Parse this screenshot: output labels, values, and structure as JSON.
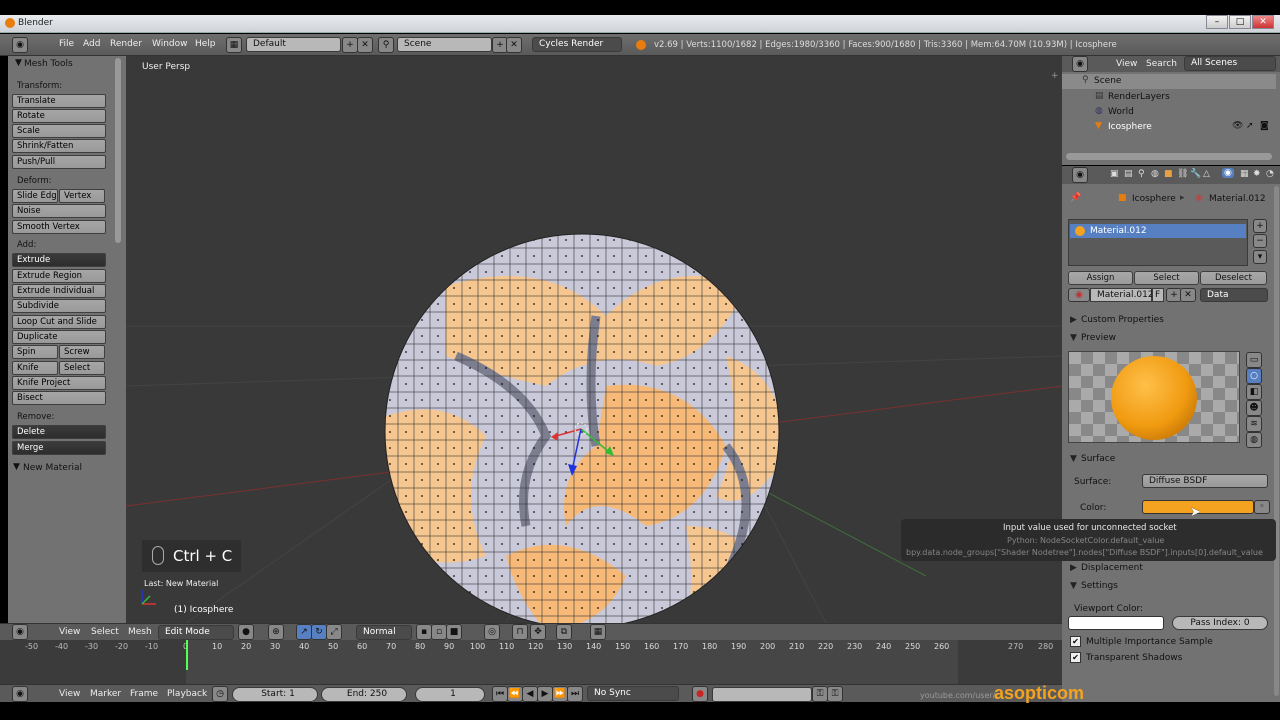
{
  "window": {
    "title": "Blender",
    "min": "–",
    "max": "□",
    "close": "✕"
  },
  "topbar": {
    "menus": [
      "File",
      "Add",
      "Render",
      "Window",
      "Help"
    ],
    "layout": "Default",
    "scene": "Scene",
    "engine": "Cycles Render",
    "stats": "v2.69 | Verts:1100/1682 | Edges:1980/3360 | Faces:900/1680 | Tris:3360 | Mem:64.70M (10.93M) | Icosphere"
  },
  "toolshelf": {
    "title": "Mesh Tools",
    "transform_label": "Transform:",
    "transform": [
      "Translate",
      "Rotate",
      "Scale",
      "Shrink/Fatten",
      "Push/Pull"
    ],
    "deform_label": "Deform:",
    "slide_edge": "Slide Edg",
    "vertex": "Vertex",
    "noise": "Noise",
    "smooth_vertex": "Smooth Vertex",
    "add_label": "Add:",
    "extrude": "Extrude",
    "extrude_region": "Extrude Region",
    "extrude_individual": "Extrude Individual",
    "subdivide": "Subdivide",
    "loop_cut": "Loop Cut and Slide",
    "duplicate": "Duplicate",
    "spin": "Spin",
    "screw": "Screw",
    "knife": "Knife",
    "select": "Select",
    "knife_project": "Knife Project",
    "bisect": "Bisect",
    "remove_label": "Remove:",
    "delete": "Delete",
    "merge": "Merge",
    "new_material": "New Material"
  },
  "viewport": {
    "view_label": "User Persp",
    "shortcut": "Ctrl + C",
    "last_op": "Last: New Material",
    "object": "(1) Icosphere"
  },
  "vheader": {
    "view": "View",
    "select": "Select",
    "mesh": "Mesh",
    "mode": "Edit Mode",
    "pivot": "Normal"
  },
  "timeline": {
    "ticks": [
      "-50",
      "-40",
      "-30",
      "-20",
      "-10",
      "0",
      "10",
      "20",
      "30",
      "40",
      "50",
      "60",
      "70",
      "80",
      "90",
      "100",
      "110",
      "120",
      "130",
      "140",
      "150",
      "160",
      "170",
      "180",
      "190",
      "200",
      "210",
      "220",
      "230",
      "240",
      "250",
      "260",
      "270",
      "280"
    ],
    "view": "View",
    "marker": "Marker",
    "frame": "Frame",
    "playback": "Playback",
    "start": "Start: 1",
    "end": "End: 250",
    "current": "1",
    "sync": "No Sync"
  },
  "outliner": {
    "view": "View",
    "search": "Search",
    "filter": "All Scenes",
    "items": [
      "Scene",
      "RenderLayers",
      "World",
      "Icosphere"
    ]
  },
  "props": {
    "breadcrumb_obj": "Icosphere",
    "breadcrumb_mat": "Material.012",
    "slot": "Material.012",
    "assign": "Assign",
    "select": "Select",
    "deselect": "Deselect",
    "matname": "Material.012",
    "f": "F",
    "data": "Data",
    "custom_props": "Custom Properties",
    "preview": "Preview",
    "surface_head": "Surface",
    "surface_label": "Surface:",
    "surface_value": "Diffuse BSDF",
    "color_label": "Color:",
    "tooltip1": "Input value used for unconnected socket",
    "tooltip2": "Python: NodeSocketColor.default_value",
    "tooltip3": "bpy.data.node_groups[\"Shader Nodetree\"].nodes[\"Diffuse BSDF\"].inputs[0].default_value",
    "displacement": "Displacement",
    "settings": "Settings",
    "viewport_color": "Viewport Color:",
    "pass_index": "Pass Index: 0",
    "mis": "Multiple Importance Sample",
    "transparent_shadows": "Transparent Shadows"
  },
  "watermark": {
    "url": "youtube.com/user/",
    "brand": "asopticom"
  },
  "colors": {
    "accent": "#f4a321",
    "selection": "#5680c2",
    "bg": "#393939"
  }
}
